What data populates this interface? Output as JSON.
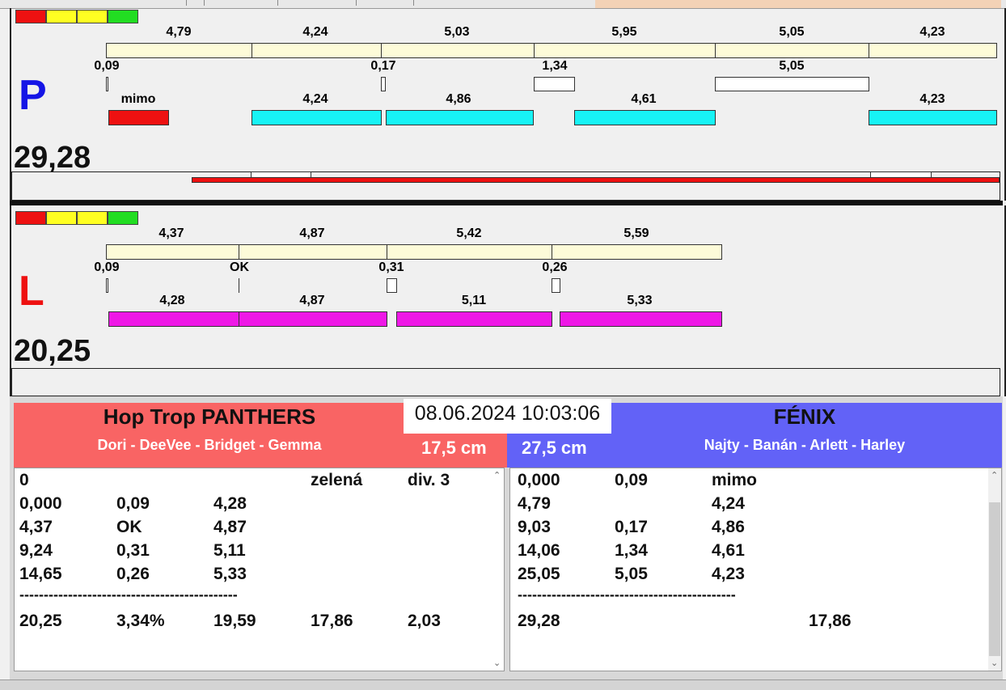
{
  "top_strip": {
    "tabs": [
      "",
      "",
      "",
      "",
      ""
    ]
  },
  "legend_colors": [
    "#ee1111",
    "#ffff22",
    "#ffff22",
    "#22dd22"
  ],
  "panel_p": {
    "side": "P",
    "side_color": "#1515e6",
    "total": "29,28",
    "row1_labels": [
      "4,79",
      "4,24",
      "5,03",
      "5,95",
      "5,05",
      "4,23"
    ],
    "row2_labels": [
      "0,09",
      "0,17",
      "1,34",
      "5,05"
    ],
    "row3_labels": [
      "mimo",
      "4,24",
      "4,86",
      "4,61",
      "4,23"
    ]
  },
  "panel_l": {
    "side": "L",
    "side_color": "#ee1111",
    "total": "20,25",
    "row1_labels": [
      "4,37",
      "4,87",
      "5,42",
      "5,59"
    ],
    "row2_labels": [
      "0,09",
      "OK",
      "0,31",
      "0,26"
    ],
    "row3_labels": [
      "4,28",
      "4,87",
      "5,11",
      "5,33"
    ]
  },
  "datetime": "08.06.2024 10:03:06",
  "team_left": {
    "name": "Hop Trop PANTHERS",
    "members": "Dori - DeeVee - Bridget - Gemma",
    "height": "17,5 cm",
    "bg": "#f96464",
    "rows": [
      [
        "0",
        "",
        "",
        "zelená",
        "div. 3"
      ],
      [
        "0,000",
        "0,09",
        "4,28",
        "",
        ""
      ],
      [
        "4,37",
        "OK",
        "4,87",
        "",
        ""
      ],
      [
        "9,24",
        "0,31",
        "5,11",
        "",
        ""
      ],
      [
        "14,65",
        "0,26",
        "5,33",
        "",
        ""
      ]
    ],
    "separator": "---------------------------------------------",
    "summary": [
      "20,25",
      "3,34%",
      "19,59",
      "17,86",
      "2,03"
    ]
  },
  "team_right": {
    "name": "FÉNIX",
    "members": "Najty - Banán - Arlett - Harley",
    "height": "27,5 cm",
    "bg": "#6262f7",
    "rows": [
      [
        "0,000",
        "0,09",
        "mimo"
      ],
      [
        "4,79",
        "",
        "4,24"
      ],
      [
        "9,03",
        "0,17",
        "4,86"
      ],
      [
        "14,06",
        "1,34",
        "4,61"
      ],
      [
        "25,05",
        "5,05",
        "4,23"
      ]
    ],
    "separator": "---------------------------------------------",
    "summary": [
      "29,28",
      "",
      "",
      "17,86"
    ]
  },
  "icons": [
    "scroll-up-icon",
    "scroll-down-icon"
  ]
}
